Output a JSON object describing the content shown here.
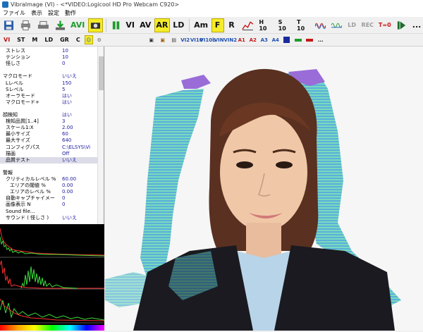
{
  "window": {
    "title": "VibraImage  (VI)   - <*VIDEO:Logicool HD Pro Webcam C920>"
  },
  "menu": [
    "ファイル",
    "表示",
    "設定",
    "動作"
  ],
  "toolbar": {
    "avi": "AVI",
    "vi": "VI",
    "av": "AV",
    "ar": "AR",
    "ld": "LD",
    "am": "Am",
    "f": "F",
    "r": "R",
    "h10": "H 10",
    "s10": "S 10",
    "t10": "T 10",
    "ld_small": "LD",
    "rec": "REC",
    "t0": "T=0",
    "more": "..."
  },
  "tabs": [
    "VI",
    "ST",
    "M",
    "LD",
    "GR",
    "C"
  ],
  "toolbar2_icons": [
    "VI2",
    "VI10",
    "VI10b",
    "VIN",
    "VIN2",
    "A1",
    "A2",
    "A3",
    "A4"
  ],
  "settings": [
    {
      "label": "ストレス",
      "value": "10",
      "indent": 1
    },
    {
      "label": "テンション",
      "value": "10",
      "indent": 1
    },
    {
      "label": "怪しさ",
      "value": "0",
      "indent": 1
    },
    {
      "label": "",
      "value": "",
      "indent": 0
    },
    {
      "label": "マクロモード",
      "value": "いいえ",
      "indent": 0
    },
    {
      "label": "Lレベル",
      "value": "150",
      "indent": 1
    },
    {
      "label": "Sレベル",
      "value": "5",
      "indent": 1
    },
    {
      "label": "オーラモード",
      "value": "はい",
      "indent": 1
    },
    {
      "label": "マクロモード+",
      "value": "はい",
      "indent": 1
    },
    {
      "label": "",
      "value": "",
      "indent": 0
    },
    {
      "label": "顔検知",
      "value": "はい",
      "indent": 0
    },
    {
      "label": "検知品質[1..4]",
      "value": "3",
      "indent": 1
    },
    {
      "label": "スケール1:X",
      "value": "2.00",
      "indent": 1
    },
    {
      "label": "最小サイズ",
      "value": "60",
      "indent": 1
    },
    {
      "label": "最大サイズ",
      "value": "640",
      "indent": 1
    },
    {
      "label": "コンフィグパス",
      "value": "C:\\ELSYS\\Vi",
      "indent": 1
    },
    {
      "label": "描画",
      "value": "Off",
      "indent": 1
    },
    {
      "label": "品質テスト",
      "value": "いいえ",
      "indent": 1,
      "selected": true
    },
    {
      "label": "",
      "value": "",
      "indent": 0
    },
    {
      "label": "警報",
      "value": "",
      "indent": 0
    },
    {
      "label": "クリティカルレベル %",
      "value": "60.00",
      "indent": 1
    },
    {
      "label": "エリアの閾値 %",
      "value": "0.00",
      "indent": 2
    },
    {
      "label": "エリアのレベル %",
      "value": "0.00",
      "indent": 2
    },
    {
      "label": "自動キャプチャイメー",
      "value": "0",
      "indent": 1
    },
    {
      "label": "画像表示 N",
      "value": "0",
      "indent": 1
    },
    {
      "label": "Sound file...",
      "value": "",
      "indent": 1
    },
    {
      "label": "サウンド ( 怪しさ )",
      "value": "いいえ",
      "indent": 1
    }
  ],
  "colors": {
    "toolbar_highlight": "#f5ec2a",
    "value_text": "#1a1aa0",
    "graph_bg": "#000000"
  }
}
